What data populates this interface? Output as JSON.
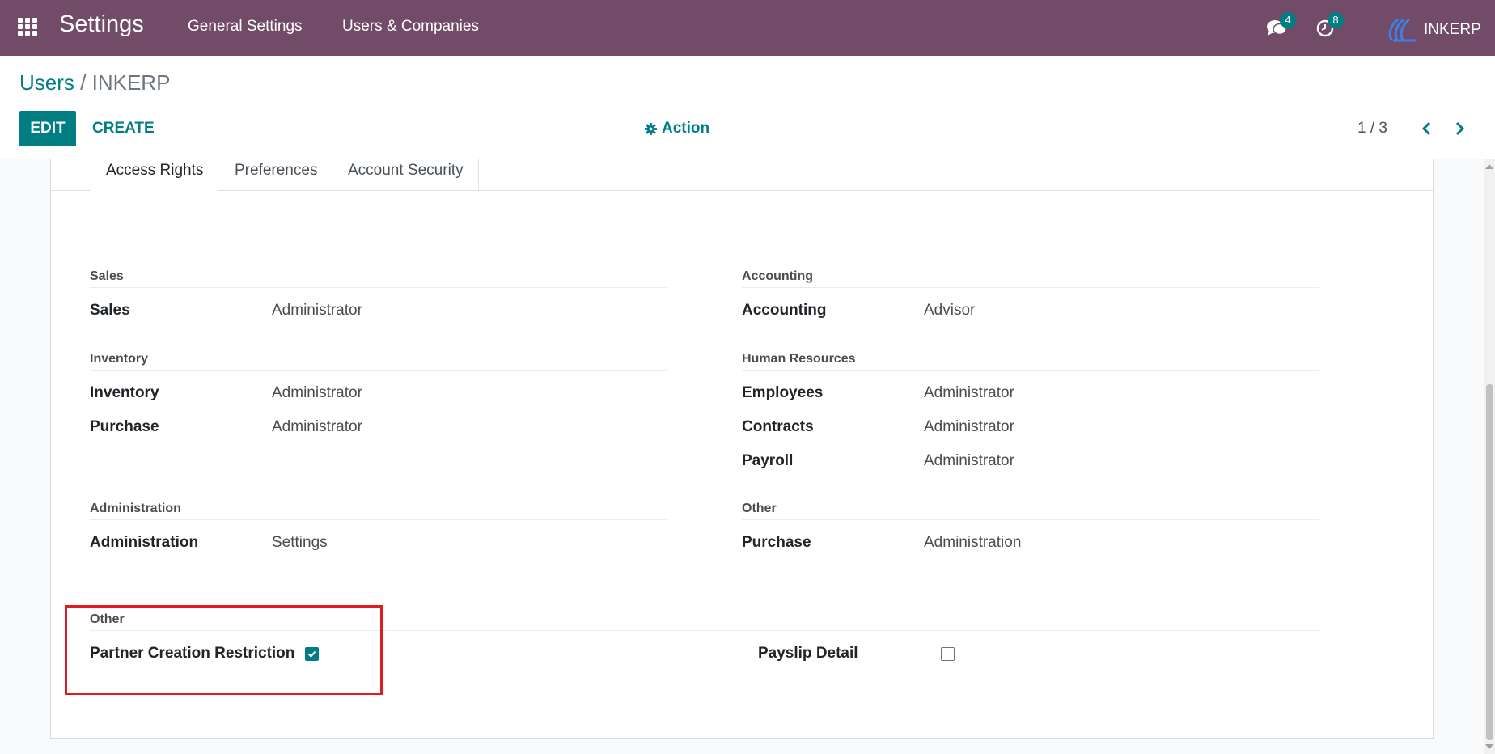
{
  "navbar": {
    "app_title": "Settings",
    "menus": [
      "General Settings",
      "Users & Companies"
    ],
    "messages_count": "4",
    "activities_count": "8",
    "company_name": "INKERP",
    "bg_color": "#714b67"
  },
  "control_panel": {
    "breadcrumb_parent": "Users",
    "breadcrumb_sep": "/",
    "breadcrumb_current": "INKERP",
    "edit_label": "EDIT",
    "create_label": "CREATE",
    "action_label": "Action",
    "pager_value": "1 / 3"
  },
  "tabs": [
    {
      "label": "Access Rights",
      "active": true
    },
    {
      "label": "Preferences",
      "active": false
    },
    {
      "label": "Account Security",
      "active": false
    }
  ],
  "groups": {
    "sales": {
      "title": "Sales",
      "fields": [
        {
          "label": "Sales",
          "value": "Administrator"
        }
      ]
    },
    "accounting": {
      "title": "Accounting",
      "fields": [
        {
          "label": "Accounting",
          "value": "Advisor"
        }
      ]
    },
    "inventory": {
      "title": "Inventory",
      "fields": [
        {
          "label": "Inventory",
          "value": "Administrator"
        },
        {
          "label": "Purchase",
          "value": "Administrator"
        }
      ]
    },
    "human_resources": {
      "title": "Human Resources",
      "fields": [
        {
          "label": "Employees",
          "value": "Administrator"
        },
        {
          "label": "Contracts",
          "value": "Administrator"
        },
        {
          "label": "Payroll",
          "value": "Administrator"
        }
      ]
    },
    "administration": {
      "title": "Administration",
      "fields": [
        {
          "label": "Administration",
          "value": "Settings"
        }
      ]
    },
    "other_right": {
      "title": "Other",
      "fields": [
        {
          "label": "Purchase",
          "value": "Administration"
        }
      ]
    },
    "other_bottom": {
      "title": "Other",
      "checkboxes": [
        {
          "label": "Partner Creation Restriction",
          "checked": true
        },
        {
          "label": "Payslip Detail",
          "checked": false
        }
      ]
    }
  },
  "colors": {
    "accent": "#017e84",
    "highlight": "#e01b24"
  }
}
